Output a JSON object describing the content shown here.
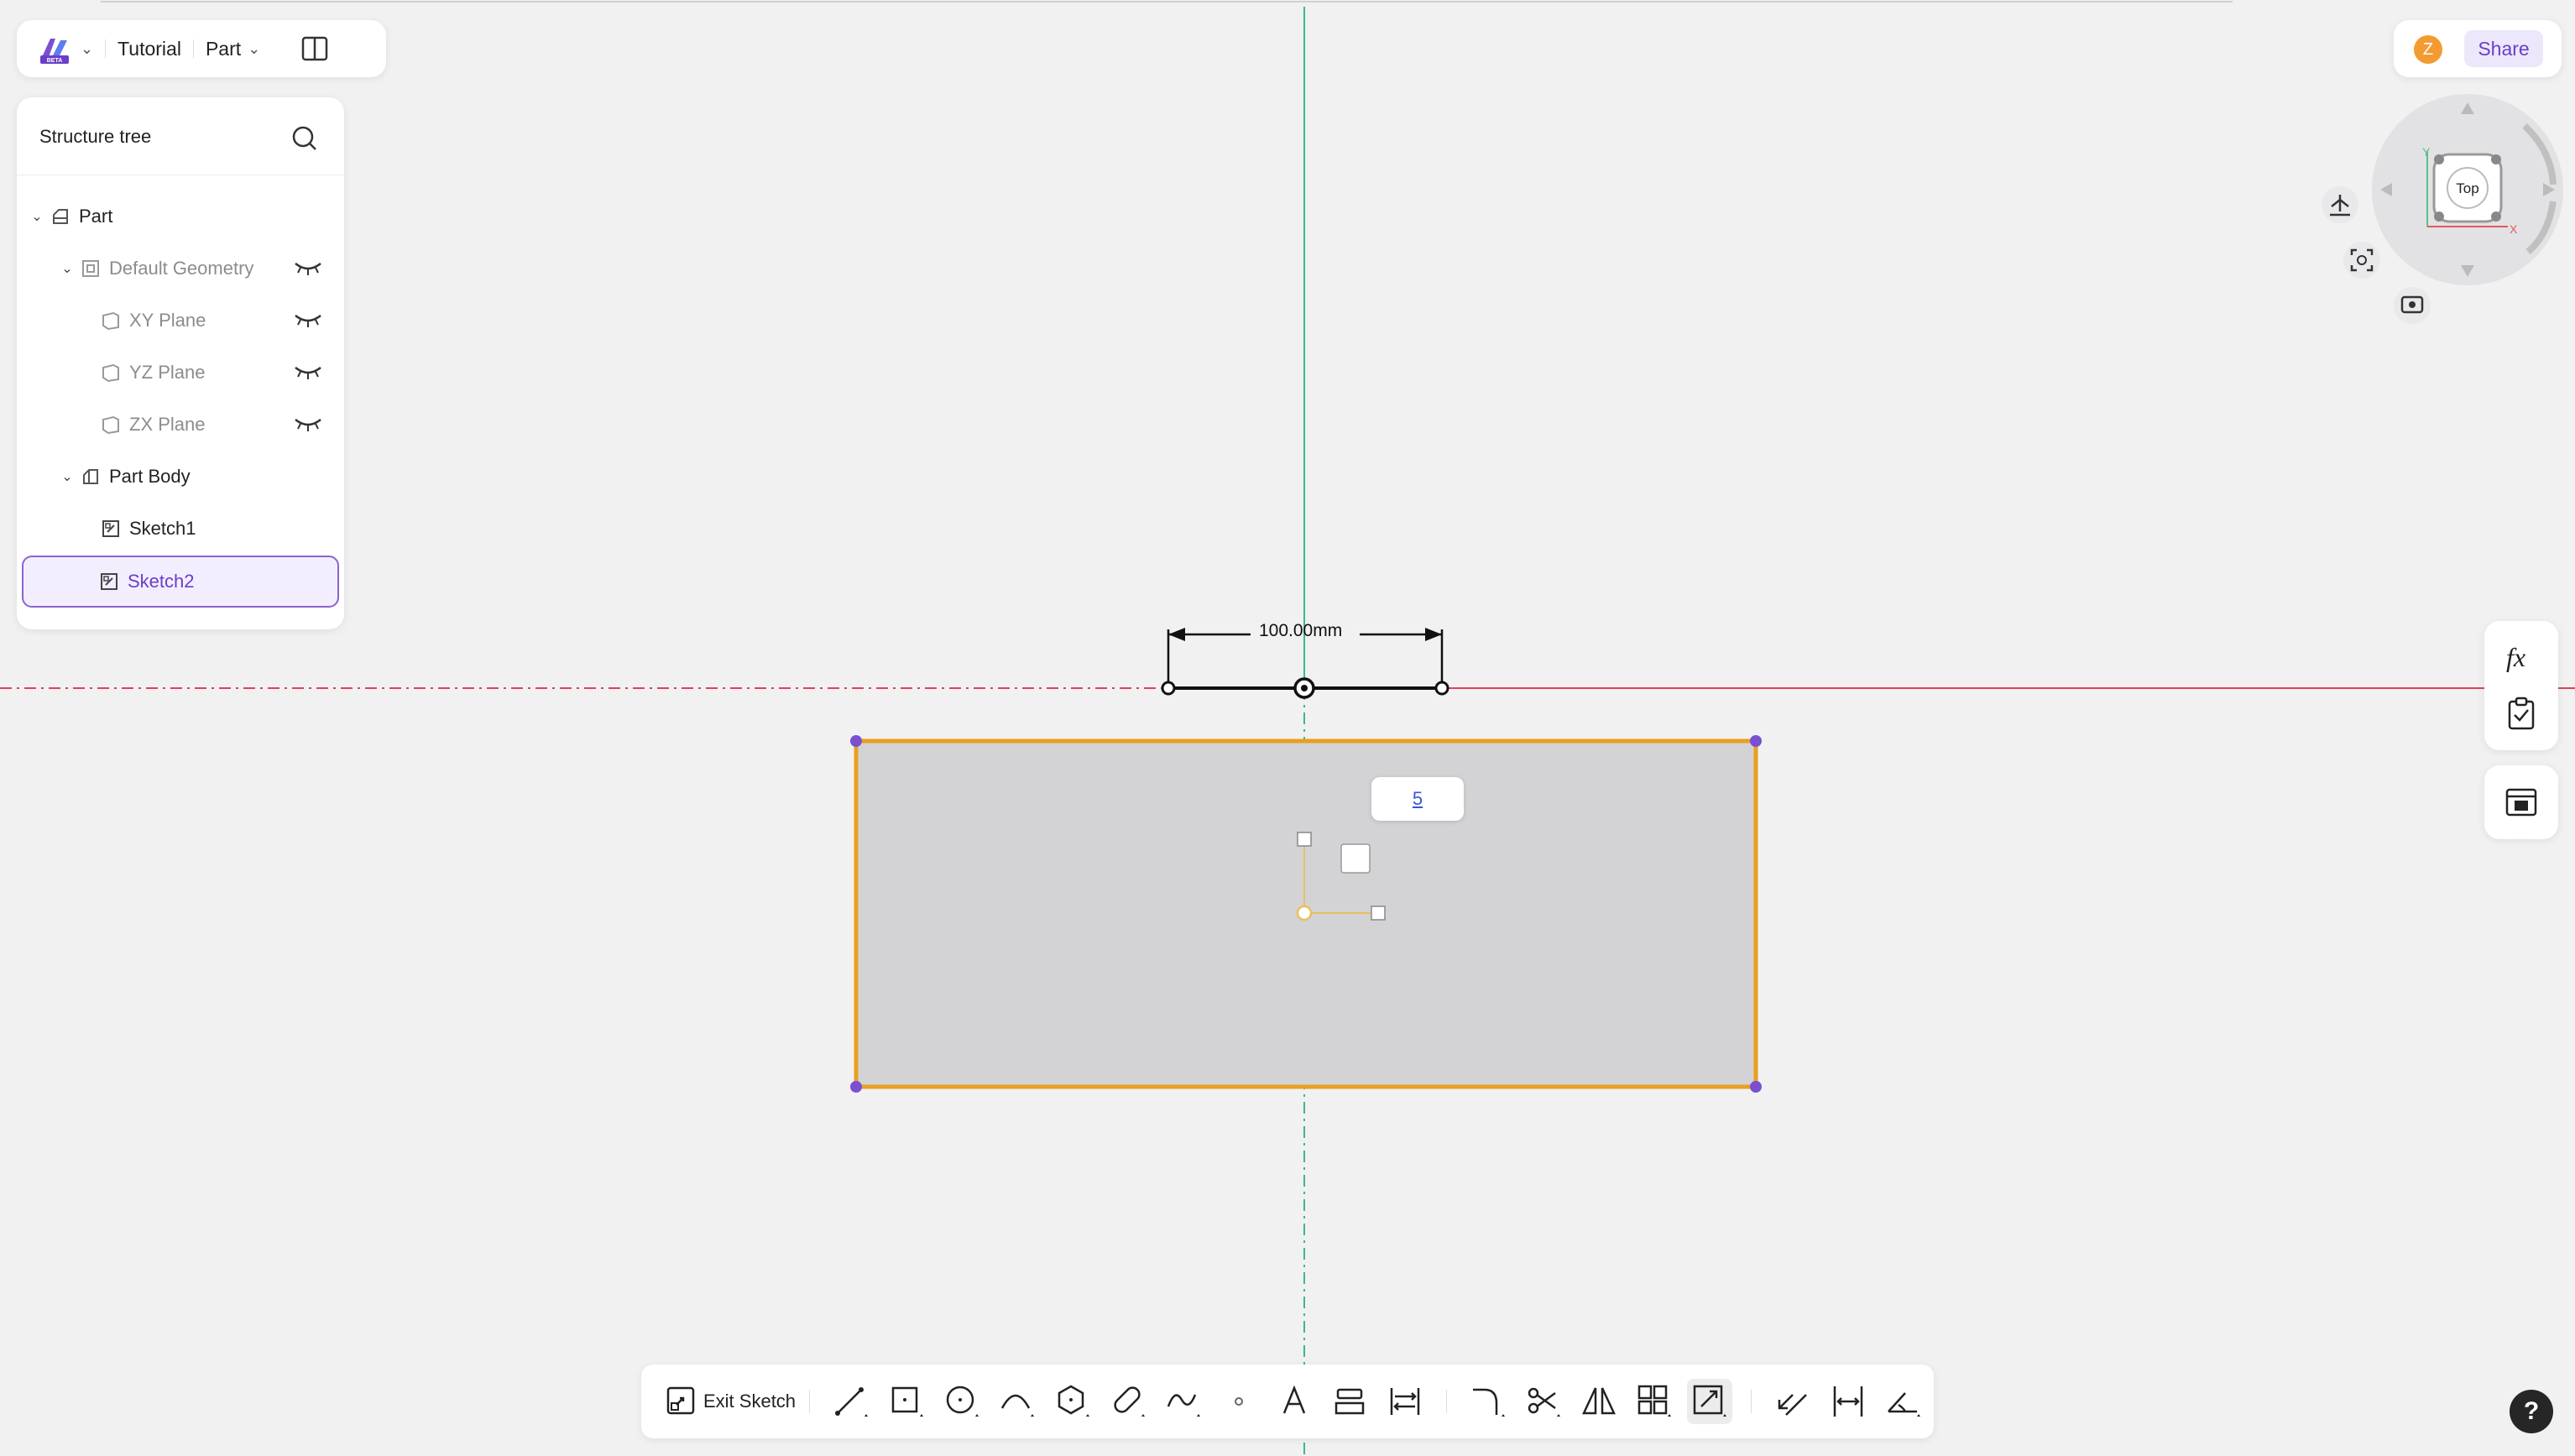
{
  "header": {
    "doc_name": "Tutorial",
    "mode": "Part",
    "logo_badge": "BETA"
  },
  "tree": {
    "title": "Structure tree",
    "items": [
      {
        "label": "Part"
      },
      {
        "label": "Default Geometry"
      },
      {
        "label": "XY Plane"
      },
      {
        "label": "YZ Plane"
      },
      {
        "label": "ZX Plane"
      },
      {
        "label": "Part Body"
      },
      {
        "label": "Sketch1"
      },
      {
        "label": "Sketch2",
        "selected": true
      }
    ]
  },
  "user": {
    "avatar_initial": "Z",
    "share_label": "Share"
  },
  "viewcube": {
    "face": "Top",
    "axis_x": "X",
    "axis_y": "Y"
  },
  "canvas": {
    "dimension_label": "100.00mm",
    "input_value": "5"
  },
  "toolbar": {
    "exit_label": "Exit Sketch"
  },
  "help": {
    "label": "?"
  },
  "colors": {
    "accent": "#6a3fc8",
    "sketch_outline": "#e8a020",
    "axis_vertical": "#3cb88e",
    "axis_horizontal": "#e0405a",
    "sketch_fill": "#d3d3d5"
  }
}
